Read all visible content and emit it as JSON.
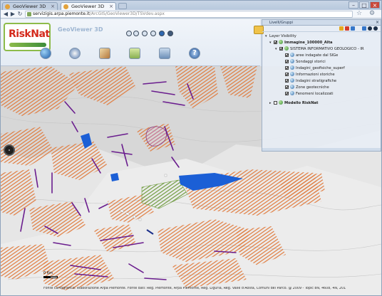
{
  "browser": {
    "tabs": [
      {
        "label": "GeoViewer 3D"
      },
      {
        "label": "GeoViewer 3D"
      }
    ],
    "url": {
      "host": "servizigis.arpa.piemonte.it",
      "path": "/ArcGIS/GeoViewer3D/TSVdev.aspx"
    }
  },
  "app": {
    "logo_text": "RiskNat",
    "title": "GeoViewer 3D",
    "colors": {
      "logo_red": "#d42a1c",
      "logo_green": "#8dbb4a",
      "hatch_orange": "#e07a3c",
      "line_purple": "#6a1d8e",
      "water_blue": "#1b5fd6"
    }
  },
  "toolbar": {
    "small_tools": [
      "zoom-in-icon",
      "zoom-out-icon",
      "rotate-icon",
      "pan-icon",
      "info-icon",
      "layers-icon"
    ],
    "big_tools": [
      "globe-icon",
      "compass-icon",
      "edit-icon",
      "layers-icon",
      "print-icon",
      "help-icon"
    ],
    "help_glyph": "?"
  },
  "layer_panel": {
    "title": "Livelli/Gruppi",
    "toolbar_icons": [
      "folder-icon",
      "add-icon",
      "remove-icon",
      "settings-icon",
      "up-icon",
      "down-icon"
    ],
    "tree": [
      {
        "label": "Layer Visibility",
        "level": 0,
        "expanded": true,
        "checked": true,
        "group": true
      },
      {
        "label": "Immagine_100000_Alta",
        "level": 1,
        "expanded": true,
        "checked": true,
        "group": true
      },
      {
        "label": "SISTEMA INFORMATIVO GEOLOGICO - IR",
        "level": 2,
        "expanded": true,
        "checked": true,
        "group": true
      },
      {
        "label": "aree indagate dal SIGe",
        "level": 3,
        "checked": true
      },
      {
        "label": "Sondaggi storici",
        "level": 3,
        "checked": true
      },
      {
        "label": "Indagini_geofisiche_superf",
        "level": 3,
        "checked": true
      },
      {
        "label": "Informazioni storiche",
        "level": 3,
        "checked": true
      },
      {
        "label": "Indagini stratigrafiche",
        "level": 3,
        "checked": true
      },
      {
        "label": "Zone geotecniche",
        "level": 3,
        "checked": true
      },
      {
        "label": "Fenomeni localizzati",
        "level": 3,
        "checked": true
      },
      {
        "label": "Modello RiskNat",
        "level": 1,
        "expanded": false,
        "checked": false,
        "group": true
      }
    ]
  },
  "map": {
    "scale_label": "0 Km",
    "attribution": "Fonte cartografica: elaborazione Arpa Piemonte. Fonte dati: Reg. Piemonte, Arpa Piemonte, Reg. Liguria, Reg. Valle d'Aosta, Comuni del Parco. @ 2009 - Topic 8N, 4608, 4N, 201"
  }
}
